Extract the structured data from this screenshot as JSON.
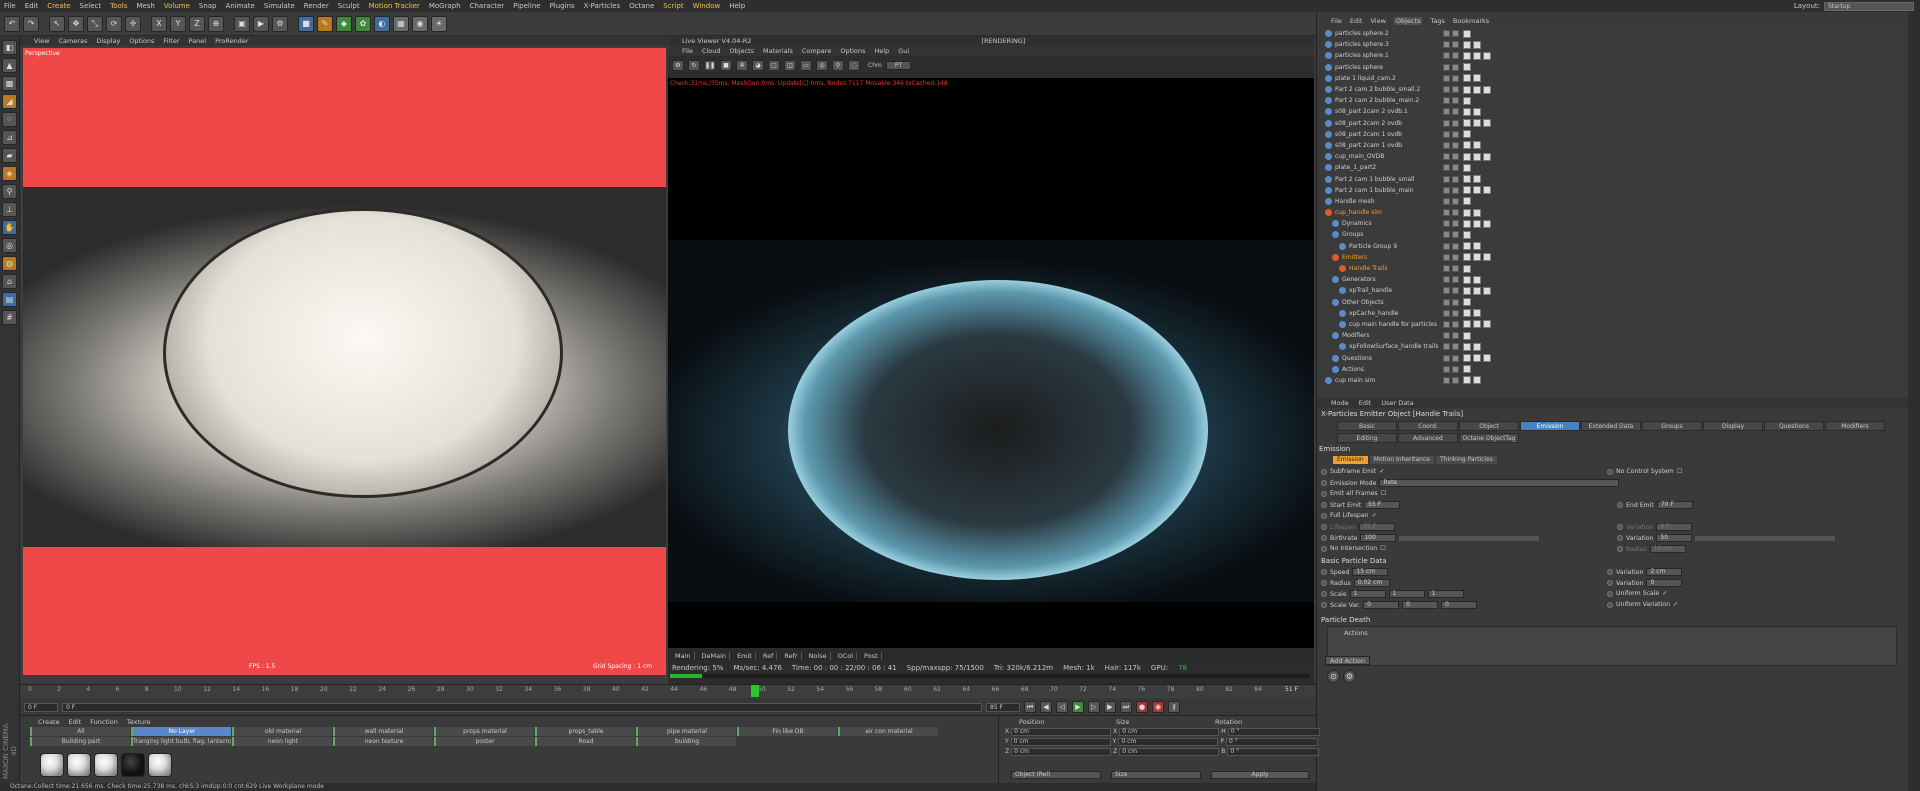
{
  "menubar": [
    "File",
    "Edit",
    "Create",
    "Select",
    "Tools",
    "Mesh",
    "Volume",
    "Snap",
    "Animate",
    "Simulate",
    "Render",
    "Sculpt",
    "Motion Tracker",
    "MoGraph",
    "Character",
    "Pipeline",
    "Plugins",
    "X-Particles",
    "Octane",
    "Script",
    "Window",
    "Help"
  ],
  "menubar_highlight": [
    "Create",
    "Tools",
    "Volume",
    "Motion Tracker",
    "Script",
    "Window"
  ],
  "layout": {
    "label": "Layout:",
    "value": "Startup"
  },
  "viewport1": {
    "menu": [
      "View",
      "Cameras",
      "Display",
      "Options",
      "Filter",
      "Panel",
      "ProRender"
    ],
    "camera": "Perspective",
    "fps": "FPS : 1.5",
    "grid": "Grid Spacing : 1 cm"
  },
  "live_viewer": {
    "title": "Live Viewer V4.04-R2",
    "state": "[RENDERING]",
    "menu": [
      "File",
      "Cloud",
      "Objects",
      "Materials",
      "Compare",
      "Options",
      "Help",
      "Gui"
    ],
    "channel": "Chm",
    "channel_value": "PT",
    "status_line": "Check:31ms./35ms. MeshGen:0ms. Update[C]:0ms. Nodes:7117 Movable:346 txCached:148",
    "tabs": [
      "Main",
      "DeMain",
      "Emit",
      "Ref",
      "Refr",
      "Noise",
      "OCol",
      "Post"
    ],
    "stats": {
      "rendering": "Rendering: 5%",
      "ms": "Ms/sec: 4.476",
      "time": "Time: 00 : 00 : 22/00 : 06 : 41",
      "spp": "Spp/maxspp: 75/1500",
      "tri": "Tri: 320k/6.212m",
      "mesh": "Mesh: 1k",
      "hair": "Hair: 117k",
      "gpu": "GPU:",
      "gpu_val": "78"
    },
    "progress": 0.05
  },
  "object_manager": {
    "menu": [
      "File",
      "Edit",
      "View",
      "Objects",
      "Tags",
      "Bookmarks"
    ],
    "active_menu": "Objects",
    "objects": [
      {
        "name": "particles sphere.2",
        "indent": 0,
        "orange": false
      },
      {
        "name": "particles sphere.3",
        "indent": 0,
        "orange": false
      },
      {
        "name": "particles sphere.1",
        "indent": 0,
        "orange": false
      },
      {
        "name": "particles sphere",
        "indent": 0,
        "orange": false
      },
      {
        "name": "plate 1 liquid_cam.2",
        "indent": 0,
        "orange": false
      },
      {
        "name": "Part 2 cam 2 bubble_small.2",
        "indent": 0,
        "orange": false
      },
      {
        "name": "Part 2 cam 2 bubble_main.2",
        "indent": 0,
        "orange": false
      },
      {
        "name": "s08_part 2cam 2 ovdb.1",
        "indent": 0,
        "orange": false
      },
      {
        "name": "s08_part 2cam 2 ovdb",
        "indent": 0,
        "orange": false
      },
      {
        "name": "s08_part 2cam 1 ovdb",
        "indent": 0,
        "orange": false
      },
      {
        "name": "s08_part 2cam 1 ovdb",
        "indent": 0,
        "orange": false
      },
      {
        "name": "cup_main_OVDB",
        "indent": 0,
        "orange": false
      },
      {
        "name": "plate_1_part2",
        "indent": 0,
        "orange": false
      },
      {
        "name": "Part 2 cam 1 bubble_small",
        "indent": 0,
        "orange": false
      },
      {
        "name": "Part 2 cam 1 bubble_main",
        "indent": 0,
        "orange": false
      },
      {
        "name": "Handle mesh",
        "indent": 0,
        "orange": false
      },
      {
        "name": "cup_handle sim",
        "indent": 0,
        "orange": true
      },
      {
        "name": "Dynamics",
        "indent": 1,
        "orange": false
      },
      {
        "name": "Groups",
        "indent": 1,
        "orange": false
      },
      {
        "name": "Particle Group 9",
        "indent": 2,
        "orange": false
      },
      {
        "name": "Emitters",
        "indent": 1,
        "orange": true
      },
      {
        "name": "Handle Trails",
        "indent": 2,
        "orange": true
      },
      {
        "name": "Generators",
        "indent": 1,
        "orange": false
      },
      {
        "name": "xpTrail_handle",
        "indent": 2,
        "orange": false
      },
      {
        "name": "Other Objects",
        "indent": 1,
        "orange": false
      },
      {
        "name": "xpCache_handle",
        "indent": 2,
        "orange": false
      },
      {
        "name": "cup main handle for particles",
        "indent": 2,
        "orange": false
      },
      {
        "name": "Modifiers",
        "indent": 1,
        "orange": false
      },
      {
        "name": "xpFollowSurface_handle trails",
        "indent": 2,
        "orange": false
      },
      {
        "name": "Questions",
        "indent": 1,
        "orange": false
      },
      {
        "name": "Actions",
        "indent": 1,
        "orange": false
      },
      {
        "name": "cup main sim",
        "indent": 0,
        "orange": false
      }
    ]
  },
  "attributes": {
    "menu": [
      "Mode",
      "Edit",
      "User Data"
    ],
    "title": "X-Particles Emitter Object [Handle Trails]",
    "tabs": [
      "Basic",
      "Coord.",
      "Object",
      "Emission",
      "Extended Data",
      "Groups",
      "Display",
      "Questions",
      "Modifiers",
      "Editing",
      "Advanced",
      "Octane ObjectTag"
    ],
    "active_tab": "Emission",
    "section": "Emission",
    "subtabs": [
      "Emission",
      "Motion Inheritance",
      "Thinking Particles"
    ],
    "props": {
      "subframe": "Subframe Emit",
      "no_control": "No Control System",
      "mode_label": "Emission Mode",
      "mode_value": "Rate",
      "emit_all": "Emit all Frames",
      "start_label": "Start Emit",
      "start_value": "55 F",
      "end_label": "End Emit",
      "end_value": "70 F",
      "full_life": "Full Lifespan",
      "lifespan_label": "Lifespan",
      "lifespan_value": "75 F",
      "variation_label": "Variation",
      "variation_value": "0 F",
      "birth_label": "Birthrate",
      "birth_value": "100",
      "variation2_value": "50",
      "no_inter": "No Intersection",
      "radius_label": "Radius",
      "radius_value": "10 cm"
    },
    "basic_data": "Basic Particle Data",
    "bpd": {
      "speed_label": "Speed",
      "speed_value": "15 cm",
      "var_label": "Variation",
      "var_speed": "2 cm",
      "radius_label": "Radius",
      "radius_value": "0.02 cm",
      "var_radius": "0",
      "scale_label": "Scale",
      "scale_x": "1",
      "scale_y": "1",
      "scale_z": "1",
      "scalevar_label": "Scale Var.",
      "sv_x": "0",
      "sv_y": "0",
      "sv_z": "0",
      "uniform_scale": "Uniform Scale",
      "uniform_var": "Uniform Variation"
    },
    "death": "Particle Death",
    "actions": "Actions",
    "add_action": "Add Action"
  },
  "timeline": {
    "ticks": [
      "0",
      "2",
      "4",
      "6",
      "8",
      "10",
      "12",
      "14",
      "16",
      "18",
      "20",
      "22",
      "24",
      "26",
      "28",
      "30",
      "32",
      "34",
      "36",
      "38",
      "40",
      "42",
      "44",
      "46",
      "48",
      "50",
      "52",
      "54",
      "56",
      "58",
      "60",
      "62",
      "64",
      "66",
      "68",
      "70",
      "72",
      "74",
      "76",
      "78",
      "80",
      "82",
      "84"
    ],
    "current": "51 F",
    "playhead": "51 F",
    "start": "0 F",
    "cur_field": "0 F",
    "end1": "85 F",
    "end2": "85 F"
  },
  "materials": {
    "menu": [
      "Create",
      "Edit",
      "Function",
      "Texture"
    ],
    "row1": [
      "All",
      "No Layer",
      "old material",
      "wall material",
      "props material",
      "props_table",
      "pipe material",
      "Fin like DB",
      "air con material"
    ],
    "row2": [
      "Building part",
      "Tranging light bulb, flag, lanterns",
      "neon light",
      "neon texture",
      "poster",
      "Road",
      "building"
    ],
    "selected": "No Layer"
  },
  "coordinates": {
    "headers": [
      "Position",
      "Size",
      "Rotation"
    ],
    "rows": [
      {
        "axis": "X",
        "pos": "0 cm",
        "size_axis": "X",
        "size": "0 cm",
        "rot_axis": "H",
        "rot": "0 °"
      },
      {
        "axis": "Y",
        "pos": "0 cm",
        "size_axis": "Y",
        "size": "0 cm",
        "rot_axis": "P",
        "rot": "0 °"
      },
      {
        "axis": "Z",
        "pos": "0 cm",
        "size_axis": "Z",
        "size": "0 cm",
        "rot_axis": "B",
        "rot": "0 °"
      }
    ],
    "mode": "Object (Rel)",
    "size_mode": "Size",
    "apply": "Apply"
  },
  "status": "Octane:Collect time:21.656 ms.  Check time:25.738 ms.  chkS:3 imdUp:0:0 cnt:629      Live Workplane mode",
  "maxon": "MAXON CINEMA 4D",
  "colors": {
    "accent": "#4a82bd",
    "orange": "#f0a030",
    "viewport_bg": "#f04848"
  }
}
